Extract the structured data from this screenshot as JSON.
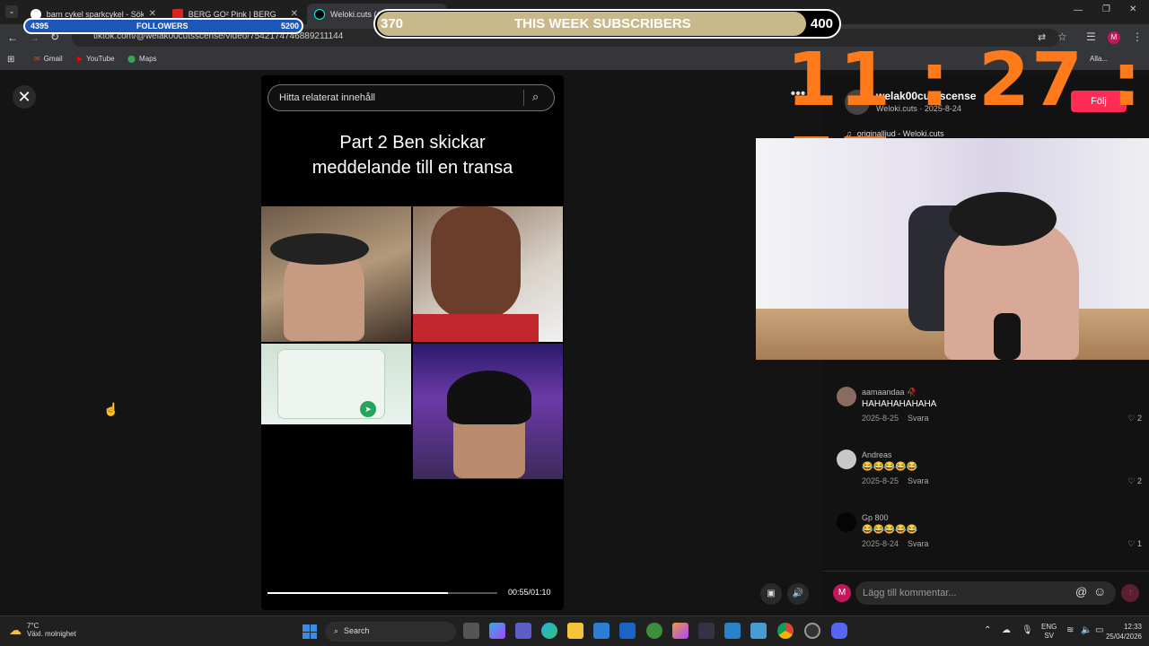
{
  "browser": {
    "tabs": [
      {
        "title": "barn cykel sparkcykel - Sök på Google",
        "favicon_color": "#ffffff"
      },
      {
        "title": "BERG GO² Pink | BERG",
        "favicon_color": "#d22"
      },
      {
        "title": "Weloki.cuts (@welak00cutsscense)",
        "favicon_color": "#000000"
      }
    ],
    "url": "tiktok.com/@welak00cutsscense/video/7542174746889211144",
    "bookmarks": [
      "Gmail",
      "YouTube",
      "Maps"
    ],
    "profile_initial": "M",
    "all_bookmarks_label": "Alla..."
  },
  "overlay": {
    "followers_current": "4395",
    "followers_label": "FOLLOWERS",
    "followers_goal": "5200",
    "followers_progress": 0.845,
    "subs_current": "370",
    "subs_label": "THIS WEEK SUBSCRIBERS",
    "subs_goal": "400",
    "subs_progress": 0.925,
    "clock": "11 : 27 : 57"
  },
  "video": {
    "search_placeholder": "Hitta relaterat innehåll",
    "caption_line1": "Part 2 Ben skickar",
    "caption_line2": "meddelande till en transa",
    "time": "00:55/01:10",
    "progress": 0.786
  },
  "creator": {
    "username": "welak00cutsscense",
    "subtitle": "Weloki.cuts · 2025-8-24",
    "follow_label": "Följ",
    "sound": "originalljud - Weloki.cuts"
  },
  "comments": [
    {
      "name": "aamaandaa 🥀",
      "text": "HAHAHAHAHAHA",
      "date": "2025-8-25",
      "reply": "Svara",
      "likes": "2",
      "avatar_color": "#8a6b60"
    },
    {
      "name": "Andreas",
      "text": "😂😂😂😂😂",
      "date": "2025-8-25",
      "reply": "Svara",
      "likes": "2",
      "avatar_color": "#c8c8c8"
    },
    {
      "name": "Gp 800",
      "text": "😂😂😂😂😂",
      "date": "2025-8-24",
      "reply": "Svara",
      "likes": "1",
      "avatar_color": "#050505"
    }
  ],
  "comment_input": {
    "placeholder": "Lägg till kommentar...",
    "user_initial": "M"
  },
  "taskbar": {
    "weather_temp": "7°C",
    "weather_desc": "Växl. molnighet",
    "search_label": "Search",
    "lang_top": "ENG",
    "lang_bottom": "SV",
    "time": "12:33",
    "date": "25/04/2026"
  }
}
